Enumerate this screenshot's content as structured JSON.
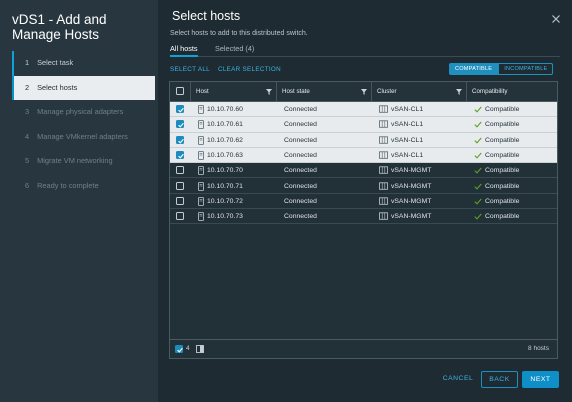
{
  "sidebar": {
    "title": "vDS1 - Add and Manage Hosts",
    "steps": [
      {
        "num": "1",
        "label": "Select task"
      },
      {
        "num": "2",
        "label": "Select hosts"
      },
      {
        "num": "3",
        "label": "Manage physical adapters"
      },
      {
        "num": "4",
        "label": "Manage VMkernel adapters"
      },
      {
        "num": "5",
        "label": "Migrate VM networking"
      },
      {
        "num": "6",
        "label": "Ready to complete"
      }
    ]
  },
  "main": {
    "title": "Select hosts",
    "subtitle": "Select hosts to add to this distributed switch.",
    "tabs": [
      "All hosts",
      "Selected (4)"
    ],
    "select_all": "SELECT ALL",
    "clear_selection": "CLEAR SELECTION",
    "toggle": {
      "compatible": "COMPATIBLE",
      "incompatible": "INCOMPATIBLE"
    },
    "columns": [
      "Host",
      "Host state",
      "Cluster",
      "Compatibility"
    ],
    "rows": [
      {
        "host": "10.10.70.60",
        "state": "Connected",
        "cluster": "vSAN-CL1",
        "compat": "Compatible",
        "checked": true
      },
      {
        "host": "10.10.70.61",
        "state": "Connected",
        "cluster": "vSAN-CL1",
        "compat": "Compatible",
        "checked": true
      },
      {
        "host": "10.10.70.62",
        "state": "Connected",
        "cluster": "vSAN-CL1",
        "compat": "Compatible",
        "checked": true
      },
      {
        "host": "10.10.70.63",
        "state": "Connected",
        "cluster": "vSAN-CL1",
        "compat": "Compatible",
        "checked": true
      },
      {
        "host": "10.10.70.70",
        "state": "Connected",
        "cluster": "vSAN-MGMT",
        "compat": "Compatible",
        "checked": false
      },
      {
        "host": "10.10.70.71",
        "state": "Connected",
        "cluster": "vSAN-MGMT",
        "compat": "Compatible",
        "checked": false
      },
      {
        "host": "10.10.70.72",
        "state": "Connected",
        "cluster": "vSAN-MGMT",
        "compat": "Compatible",
        "checked": false
      },
      {
        "host": "10.10.70.73",
        "state": "Connected",
        "cluster": "vSAN-MGMT",
        "compat": "Compatible",
        "checked": false
      }
    ],
    "footer": {
      "selected_count": "4",
      "total": "8 hosts"
    }
  },
  "buttons": {
    "cancel": "CANCEL",
    "back": "BACK",
    "next": "NEXT"
  },
  "colors": {
    "accent": "#0ba3da",
    "primary_button": "#0f8fc7",
    "selected_row": "#e7ebee",
    "compatible_check": "#5aa220"
  }
}
